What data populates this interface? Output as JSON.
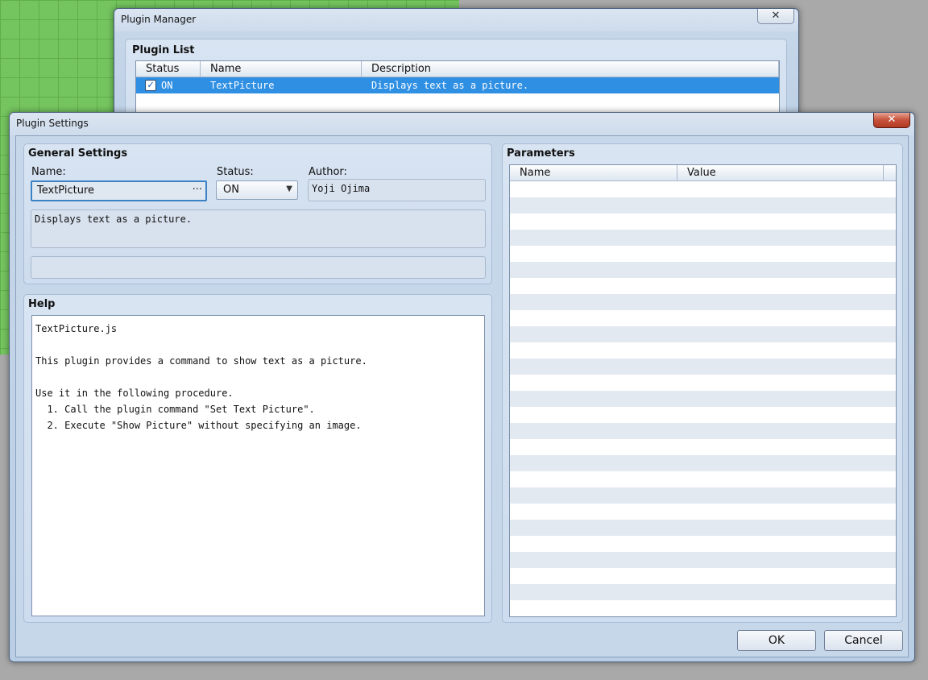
{
  "plugin_manager": {
    "title": "Plugin Manager",
    "close": "✕",
    "plugin_list": {
      "title": "Plugin List",
      "columns": [
        "Status",
        "Name",
        "Description"
      ],
      "rows": [
        {
          "status": "ON",
          "checked": true,
          "name": "TextPicture",
          "description": "Displays text as a picture."
        }
      ]
    }
  },
  "plugin_settings": {
    "title": "Plugin Settings",
    "close": "✕",
    "general": {
      "title": "General Settings",
      "name_label": "Name:",
      "name_value": "TextPicture",
      "name_button": "···",
      "status_label": "Status:",
      "status_value": "ON",
      "author_label": "Author:",
      "author_value": "Yoji Ojima",
      "description": "Displays text as a picture.",
      "extra": ""
    },
    "help": {
      "title": "Help",
      "text": "TextPicture.js\n\nThis plugin provides a command to show text as a picture.\n\nUse it in the following procedure.\n  1. Call the plugin command \"Set Text Picture\".\n  2. Execute \"Show Picture\" without specifying an image."
    },
    "parameters": {
      "title": "Parameters",
      "columns": [
        "Name",
        "Value"
      ],
      "rows": []
    },
    "ok_label": "OK",
    "cancel_label": "Cancel"
  }
}
